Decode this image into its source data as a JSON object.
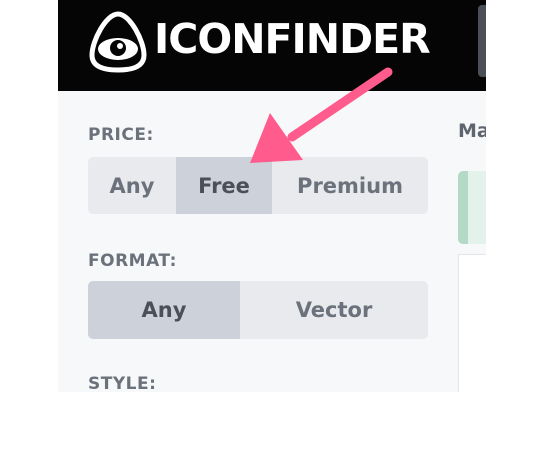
{
  "header": {
    "brand": "ICONFINDER"
  },
  "filters": {
    "price": {
      "label": "PRICE:",
      "options": [
        "Any",
        "Free",
        "Premium"
      ],
      "selected": "Free"
    },
    "format": {
      "label": "FORMAT:",
      "options": [
        "Any",
        "Vector"
      ],
      "selected": "Any"
    },
    "style": {
      "label": "STYLE:"
    }
  },
  "main": {
    "title_partial": "Ma"
  },
  "colors": {
    "annotation_arrow": "#ff5c8d",
    "header_bg": "#050505",
    "selected_bg": "#cdd2da"
  }
}
